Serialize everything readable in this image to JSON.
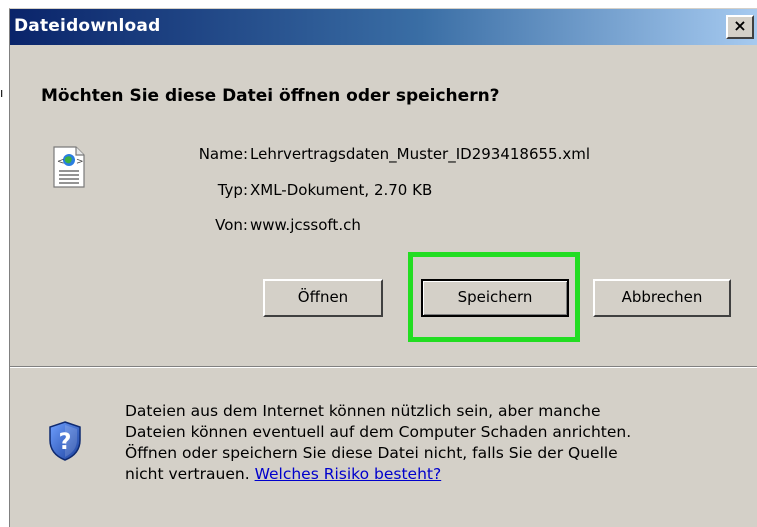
{
  "window": {
    "title": "Dateidownload",
    "close_label": "×"
  },
  "dialog": {
    "question": "Möchten Sie diese Datei öffnen oder speichern?",
    "file": {
      "name_label": "Name:",
      "name_value": "Lehrvertragsdaten_Muster_ID293418655.xml",
      "type_label": "Typ:",
      "type_value": "XML-Dokument, 2.70 KB",
      "from_label": "Von:",
      "from_value": "www.jcssoft.ch"
    },
    "buttons": {
      "open": "Öffnen",
      "save": "Speichern",
      "cancel": "Abbrechen"
    },
    "warning": {
      "line1": "Dateien aus dem Internet können nützlich sein, aber manche",
      "line2": "Dateien können eventuell auf dem Computer Schaden anrichten.",
      "line3": "Öffnen oder speichern Sie diese Datei nicht, falls Sie der Quelle",
      "line4_text": "nicht vertrauen. ",
      "link": "Welches Risiko besteht?"
    }
  },
  "colors": {
    "highlight": "#22dd22",
    "titlebar_start": "#0a246a",
    "titlebar_end": "#a6caf0",
    "dialog_bg": "#d4d0c8",
    "link": "#0000cc"
  },
  "icons": {
    "file": "xml-file-icon",
    "warning": "security-shield-icon"
  }
}
